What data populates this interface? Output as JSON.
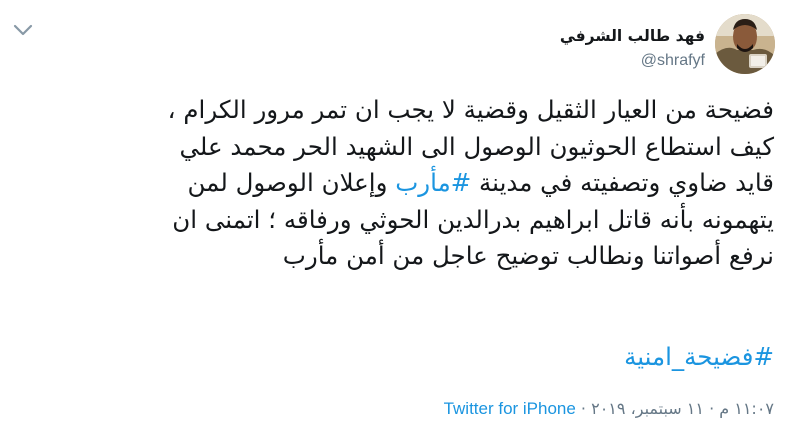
{
  "tweet": {
    "author": {
      "display_name": "فهد طالب الشرفي",
      "handle": "@shrafyf"
    },
    "body_lines": [
      [
        {
          "text": "فضيحة من العيار الثقيل وقضية لا يجب ان تمر مرور الكرام ،"
        }
      ],
      [
        {
          "text": "كيف استطاع الحوثيون الوصول الى الشهيد الحر محمد علي"
        }
      ],
      [
        {
          "text": "قايد ضاوي وتصفيته في مدينة "
        },
        {
          "text": "#مأرب",
          "link": true
        },
        {
          "text": " وإعلان الوصول لمن"
        }
      ],
      [
        {
          "text": "يتهمونه بأنه قاتل ابراهيم بدرالدين الحوثي ورفاقه ؛ اتمنى ان"
        }
      ],
      [
        {
          "text": "نرفع أصواتنا ونطالب توضيح عاجل من أمن مأرب"
        }
      ]
    ],
    "hashtag": "#فضيحة_امنية",
    "timestamp": "١١:٠٧ م · ١١ سبتمبر، ٢٠١٩",
    "separator": " · ",
    "source": "Twitter for iPhone",
    "colors": {
      "link": "#1b95e0",
      "text": "#14171a",
      "muted": "#657786"
    },
    "icons": {
      "menu": "chevron-down-icon",
      "avatar": "avatar-image"
    }
  }
}
